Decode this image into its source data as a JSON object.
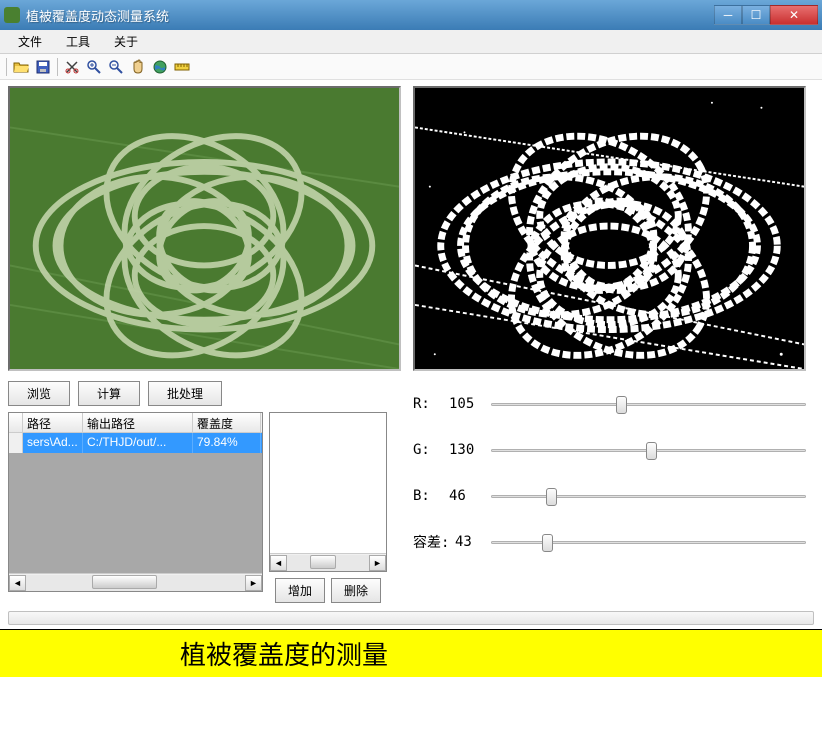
{
  "window": {
    "title": "植被覆盖度动态测量系统"
  },
  "menu": {
    "file": "文件",
    "tool": "工具",
    "about": "关于"
  },
  "toolbar_icons": {
    "open": "open-icon",
    "save": "save-icon",
    "cut": "cut-icon",
    "zoomin": "zoom-in-icon",
    "zoomout": "zoom-out-icon",
    "hand": "hand-icon",
    "globe": "globe-icon",
    "ruler": "ruler-icon"
  },
  "buttons": {
    "browse": "浏览",
    "calc": "计算",
    "batch": "批处理",
    "add": "增加",
    "delete": "删除"
  },
  "table": {
    "headers": {
      "path": "路径",
      "outpath": "输出路径",
      "coverage": "覆盖度"
    },
    "rows": [
      {
        "path": "sers\\Ad...",
        "outpath": "C:/THJD/out/...",
        "coverage": "79.84%"
      }
    ]
  },
  "sliders": {
    "r": {
      "label": "R:",
      "value": 105,
      "min": 0,
      "max": 255
    },
    "g": {
      "label": "G:",
      "value": 130,
      "min": 0,
      "max": 255
    },
    "b": {
      "label": "B:",
      "value": 46,
      "min": 0,
      "max": 255
    },
    "tol": {
      "label": "容差:",
      "value": 43,
      "min": 0,
      "max": 255
    }
  },
  "caption": "植被覆盖度的测量"
}
